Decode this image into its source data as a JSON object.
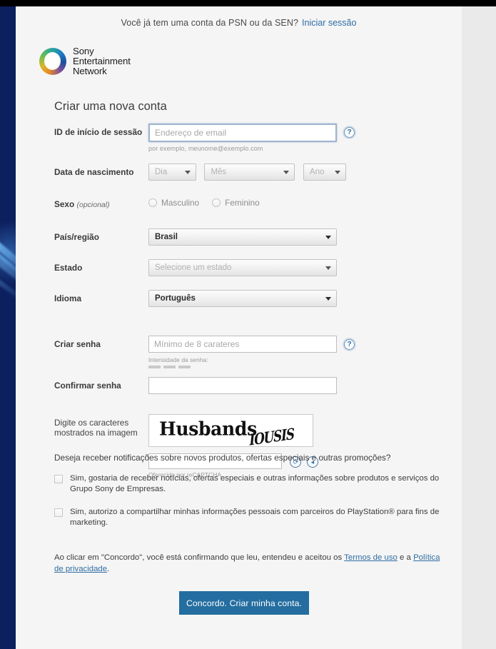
{
  "header": {
    "prompt": "Você já tem uma conta da PSN ou da SEN?",
    "login_link": "Iniciar sessão"
  },
  "logo": {
    "line1": "Sony",
    "line2": "Entertainment",
    "line3": "Network"
  },
  "form": {
    "title": "Criar uma nova conta",
    "login_id": {
      "label": "ID de início de sessão",
      "placeholder": "Endereço de email",
      "value": "",
      "hint": "por exemplo, meunome@exemplo.com",
      "help": "?"
    },
    "birthdate": {
      "label": "Data de nascimento",
      "day": "Dia",
      "month": "Mês",
      "year": "Ano"
    },
    "gender": {
      "label": "Sexo",
      "optional": "(opcional)",
      "male": "Masculino",
      "female": "Feminino"
    },
    "country": {
      "label": "País/região",
      "value": "Brasil"
    },
    "state": {
      "label": "Estado",
      "value": "Selecione um estado"
    },
    "language": {
      "label": "Idioma",
      "value": "Português"
    },
    "password": {
      "label": "Criar senha",
      "placeholder": "Mínimo de 8 carateres",
      "value": "",
      "help": "?",
      "strength_label": "Intensidade da senha:"
    },
    "confirm_password": {
      "label": "Confirmar senha",
      "placeholder": "",
      "value": ""
    },
    "captcha": {
      "label_line1": "Digite os caracteres",
      "label_line2": "mostrados na imagem",
      "word1": "Husbands",
      "word2": "IOUSIS",
      "input_value": "",
      "note": "Oferecido por reCAPTCHA",
      "refresh_icon": "⟳",
      "audio_icon": "◂"
    }
  },
  "promo": {
    "question": "Deseja receber notificações sobre novos produtos, ofertas especiais e outras promoções?",
    "option1": "Sim, gostaria de receber notícias, ofertas especiais e outras informações sobre produtos e serviços do Grupo Sony de Empresas.",
    "option2": "Sim, autorizo a compartilhar minhas informações pessoais com parceiros do PlayStation® para fins de marketing."
  },
  "terms": {
    "prefix": "Ao clicar em \"Concordo\", você está confirmando que leu, entendeu e aceitou os ",
    "link_terms": "Termos de uso",
    "middle": " e a ",
    "link_privacy": "Política de privacidade",
    "suffix": "."
  },
  "submit": {
    "label": "Concordo. Criar minha conta."
  },
  "colors": {
    "brand_navy": "#0c1f5e",
    "accent_blue": "#246da4",
    "link_blue": "#2e6da4",
    "page_bg": "#f5f5f5"
  }
}
